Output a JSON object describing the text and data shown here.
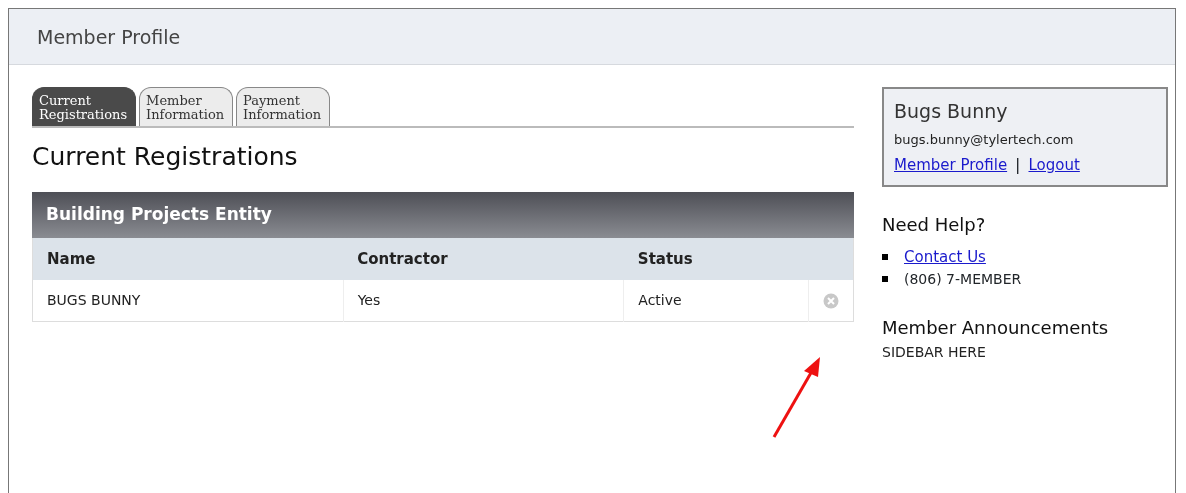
{
  "header": {
    "title": "Member Profile"
  },
  "tabs": [
    {
      "label": "Current Registrations",
      "selected": true
    },
    {
      "label": "Member Information",
      "selected": false
    },
    {
      "label": "Payment Information",
      "selected": false
    }
  ],
  "heading": "Current Registrations",
  "table": {
    "title": "Building Projects Entity",
    "columns": [
      "Name",
      "Contractor",
      "Status"
    ],
    "rows": [
      {
        "cells": [
          "BUGS BUNNY",
          "Yes",
          "Active"
        ]
      }
    ]
  },
  "user_box": {
    "name": "Bugs Bunny",
    "email": "bugs.bunny@tylertech.com",
    "links": [
      "Member Profile",
      "Logout"
    ],
    "separator": "|"
  },
  "help": {
    "title": "Need Help?",
    "items": [
      {
        "kind": "link",
        "text": "Contact Us"
      },
      {
        "kind": "text",
        "text": "(806) 7-MEMBER"
      }
    ]
  },
  "announcements": {
    "title": "Member Announcements",
    "text": "SIDEBAR HERE"
  }
}
